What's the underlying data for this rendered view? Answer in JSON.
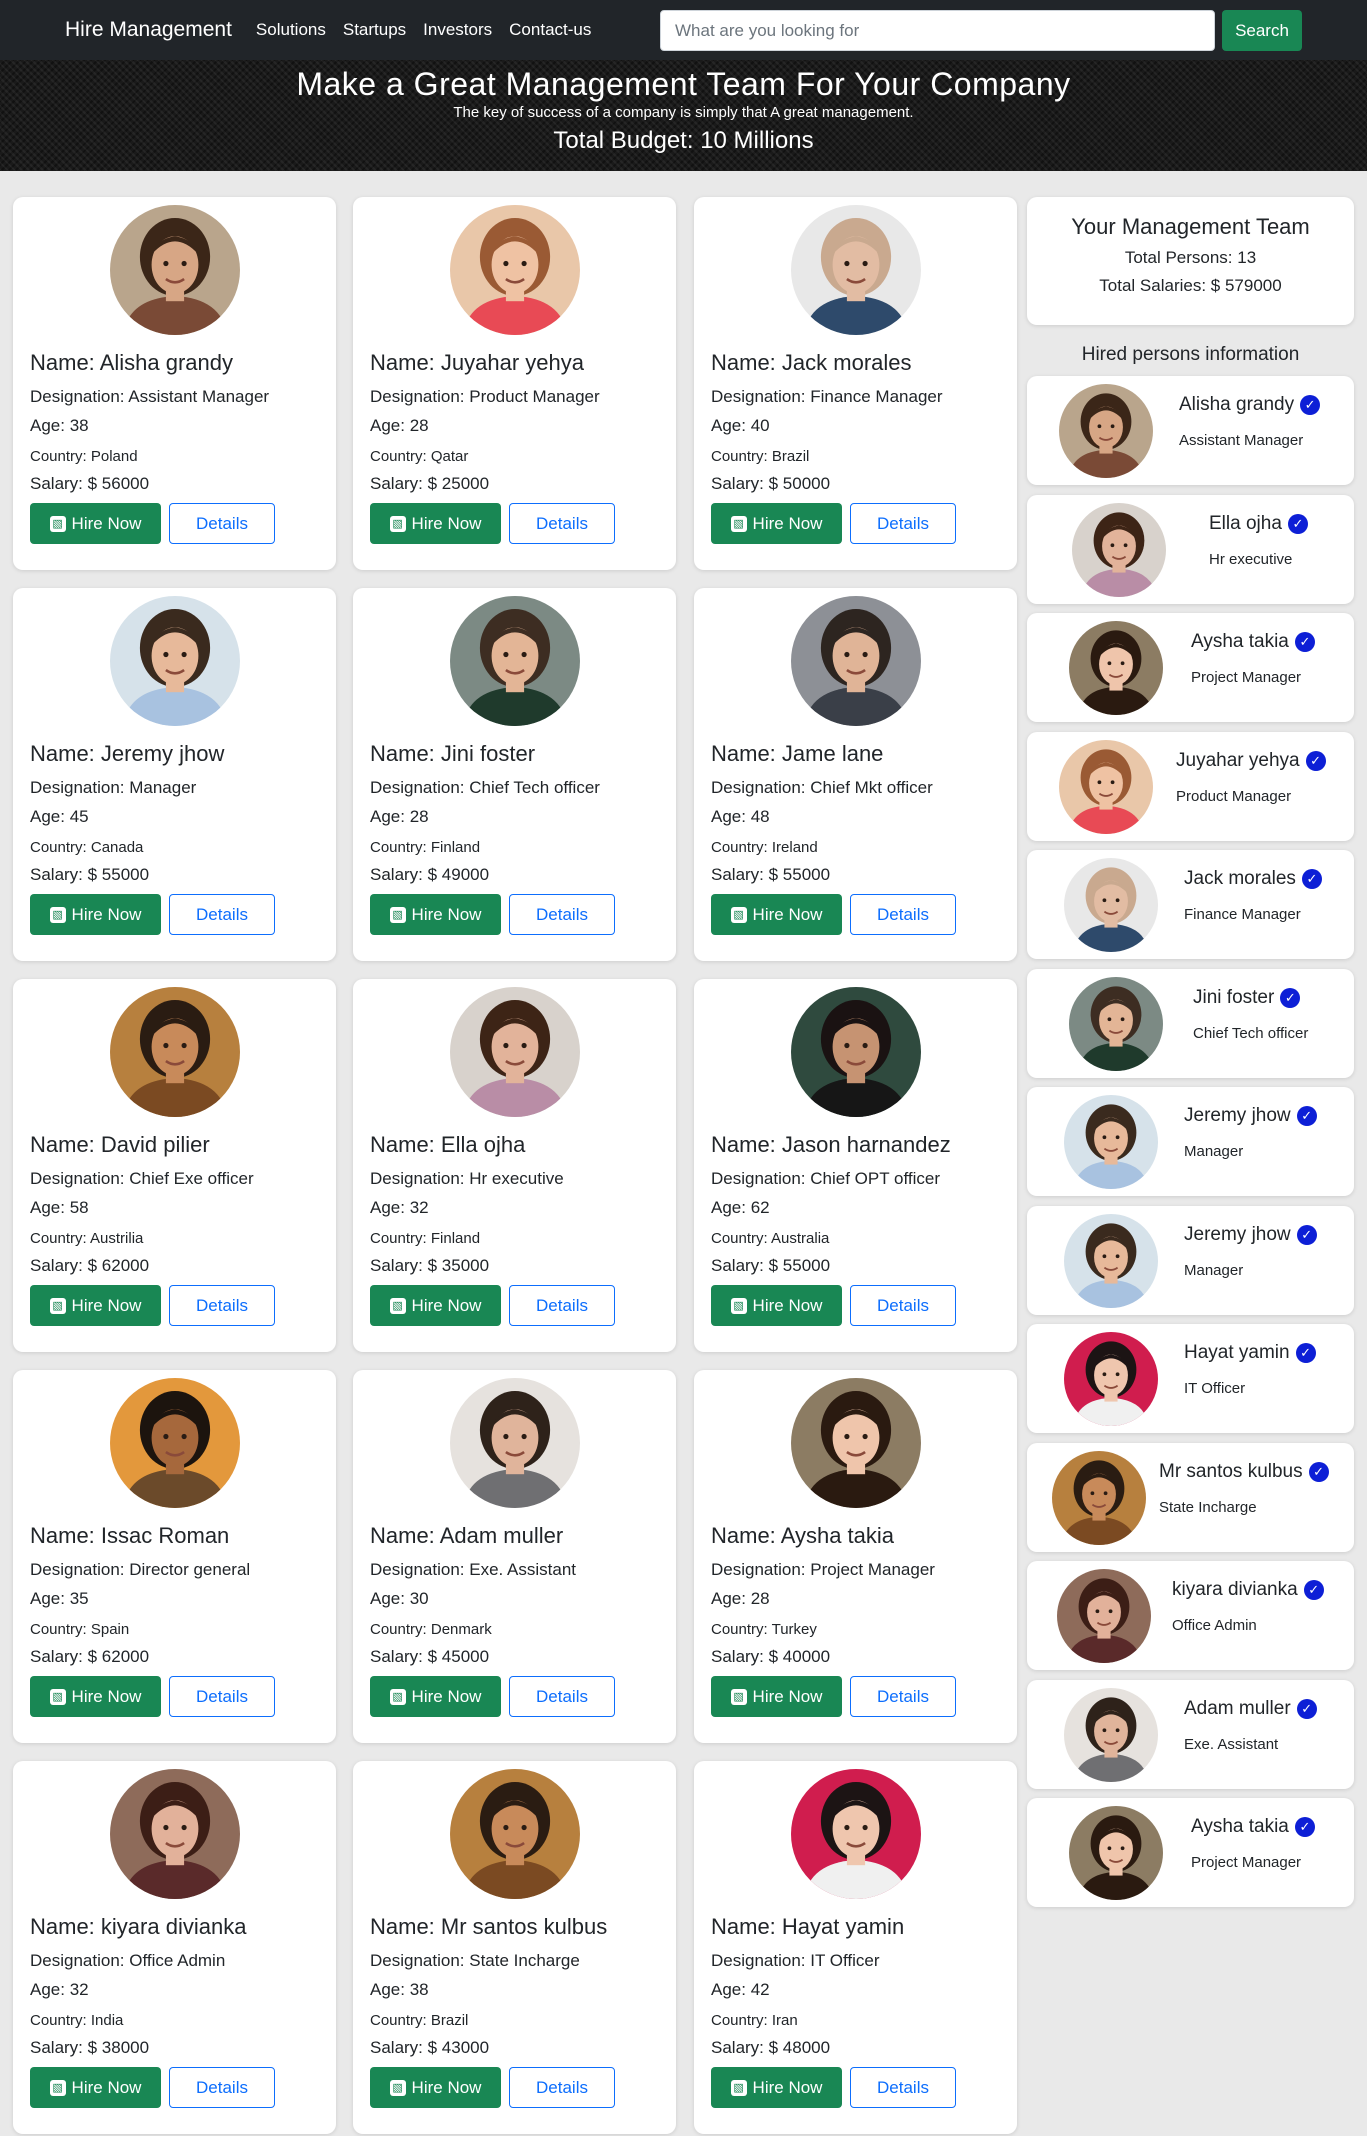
{
  "nav": {
    "brand": "Hire Management",
    "links": [
      "Solutions",
      "Startups",
      "Investors",
      "Contact-us"
    ],
    "search_placeholder": "What are you looking for",
    "search_button": "Search"
  },
  "hero": {
    "title": "Make a Great Management Team For Your Company",
    "subtitle": "The key of success of a company is simply that A great management.",
    "budget": "Total Budget: 10 Millions"
  },
  "buttons": {
    "hire": "Hire Now",
    "details": "Details"
  },
  "cards": [
    {
      "name": "Name: Alisha grandy",
      "designation": "Designation: Assistant Manager",
      "age": "Age: 38",
      "country": "Country: Poland",
      "salary": "Salary: $ 56000",
      "bg": "#b9a58c",
      "hair": "#3b2618",
      "skin": "#d7a685",
      "shirt": "#7a4a36"
    },
    {
      "name": "Name: Juyahar yehya",
      "designation": "Designation: Product Manager",
      "age": "Age: 28",
      "country": "Country: Qatar",
      "salary": "Salary: $ 25000",
      "bg": "#e9c7a9",
      "hair": "#9a5a34",
      "skin": "#efc2a3",
      "shirt": "#e84a55"
    },
    {
      "name": "Name: Jack morales",
      "designation": "Designation: Finance Manager",
      "age": "Age: 40",
      "country": "Country: Brazil",
      "salary": "Salary: $ 50000",
      "bg": "#e8e8e8",
      "hair": "#c9a98f",
      "skin": "#e2bca3",
      "shirt": "#2e4a6b"
    },
    {
      "name": "Name: Jeremy jhow",
      "designation": "Designation: Manager",
      "age": "Age: 45",
      "country": "Country: Canada",
      "salary": "Salary: $ 55000",
      "bg": "#d6e2ea",
      "hair": "#3a2a1e",
      "skin": "#e7b99a",
      "shirt": "#a8c2e0"
    },
    {
      "name": "Name: Jini foster",
      "designation": "Designation: Chief Tech officer",
      "age": "Age: 28",
      "country": "Country: Finland",
      "salary": "Salary: $ 49000",
      "bg": "#7c8a84",
      "hair": "#3d2d22",
      "skin": "#e3b596",
      "shirt": "#1f3a2c"
    },
    {
      "name": "Name: Jame lane",
      "designation": "Designation: Chief Mkt officer",
      "age": "Age: 48",
      "country": "Country: Ireland",
      "salary": "Salary: $ 55000",
      "bg": "#8d9096",
      "hair": "#2d2520",
      "skin": "#e0b497",
      "shirt": "#3a3f48"
    },
    {
      "name": "Name: David pilier",
      "designation": "Designation: Chief Exe officer",
      "age": "Age: 58",
      "country": "Country: Austrilia",
      "salary": "Salary: $ 62000",
      "bg": "#b7803e",
      "hair": "#2a1c12",
      "skin": "#c88a5a",
      "shirt": "#7b4a22"
    },
    {
      "name": "Name: Ella ojha",
      "designation": "Designation: Hr executive",
      "age": "Age: 32",
      "country": "Country: Finland",
      "salary": "Salary: $ 35000",
      "bg": "#d8d2cc",
      "hair": "#3d2416",
      "skin": "#e2b39a",
      "shirt": "#b98da6"
    },
    {
      "name": "Name: Jason harnandez",
      "designation": "Designation: Chief OPT officer",
      "age": "Age: 62",
      "country": "Country: Australia",
      "salary": "Salary: $ 55000",
      "bg": "#2f4a3e",
      "hair": "#1a1212",
      "skin": "#c69372",
      "shirt": "#161616"
    },
    {
      "name": "Name: Issac Roman",
      "designation": "Designation: Director general",
      "age": "Age: 35",
      "country": "Country: Spain",
      "salary": "Salary: $ 62000",
      "bg": "#e3983c",
      "hair": "#1c140e",
      "skin": "#a6683c",
      "shirt": "#6b4a2a"
    },
    {
      "name": "Name: Adam muller",
      "designation": "Designation: Exe. Assistant",
      "age": "Age: 30",
      "country": "Country: Denmark",
      "salary": "Salary: $ 45000",
      "bg": "#e6e2de",
      "hair": "#2e221a",
      "skin": "#e0b49b",
      "shirt": "#6f6f72"
    },
    {
      "name": "Name: Aysha takia",
      "designation": "Designation: Project Manager",
      "age": "Age: 28",
      "country": "Country: Turkey",
      "salary": "Salary: $ 40000",
      "bg": "#8c7c63",
      "hair": "#2a1a10",
      "skin": "#efc5ab",
      "shirt": "#2a1a10"
    },
    {
      "name": "Name: kiyara divianka",
      "designation": "Designation: Office Admin",
      "age": "Age: 32",
      "country": "Country: India",
      "salary": "Salary: $ 38000",
      "bg": "#8e6b5a",
      "hair": "#3c1e16",
      "skin": "#e2b19a",
      "shirt": "#5a2a2a"
    },
    {
      "name": "Name: Mr santos kulbus",
      "designation": "Designation: State Incharge",
      "age": "Age: 38",
      "country": "Country: Brazil",
      "salary": "Salary: $ 43000",
      "bg": "#b7803e",
      "hair": "#2a1c12",
      "skin": "#c88a5a",
      "shirt": "#7b4a22"
    },
    {
      "name": "Name: Hayat yamin",
      "designation": "Designation: IT Officer",
      "age": "Age: 42",
      "country": "Country: Iran",
      "salary": "Salary: $ 48000",
      "bg": "#d01d4e",
      "hair": "#1c1414",
      "skin": "#efc6ae",
      "shirt": "#f0f0f0"
    }
  ],
  "team": {
    "title": "Your Management Team",
    "total_persons": "Total Persons: 13",
    "total_salaries": "Total Salaries: $ 579000"
  },
  "hired_title": "Hired persons information",
  "hired": [
    {
      "name": "Alisha grandy",
      "designation": "Assistant Manager",
      "bg": "#b9a58c",
      "hair": "#3b2618",
      "skin": "#d7a685",
      "shirt": "#7a4a36"
    },
    {
      "name": "Ella ojha",
      "designation": "Hr executive",
      "bg": "#d8d2cc",
      "hair": "#3d2416",
      "skin": "#e2b39a",
      "shirt": "#b98da6"
    },
    {
      "name": "Aysha takia",
      "designation": "Project Manager",
      "bg": "#8c7c63",
      "hair": "#2a1a10",
      "skin": "#efc5ab",
      "shirt": "#2a1a10"
    },
    {
      "name": "Juyahar yehya",
      "designation": "Product Manager",
      "bg": "#e9c7a9",
      "hair": "#9a5a34",
      "skin": "#efc2a3",
      "shirt": "#e84a55"
    },
    {
      "name": "Jack morales",
      "designation": "Finance Manager",
      "bg": "#e8e8e8",
      "hair": "#c9a98f",
      "skin": "#e2bca3",
      "shirt": "#2e4a6b"
    },
    {
      "name": "Jini foster",
      "designation": "Chief Tech officer",
      "bg": "#7c8a84",
      "hair": "#3d2d22",
      "skin": "#e3b596",
      "shirt": "#1f3a2c"
    },
    {
      "name": "Jeremy jhow",
      "designation": "Manager",
      "bg": "#d6e2ea",
      "hair": "#3a2a1e",
      "skin": "#e7b99a",
      "shirt": "#a8c2e0"
    },
    {
      "name": "Jeremy jhow",
      "designation": "Manager",
      "bg": "#d6e2ea",
      "hair": "#3a2a1e",
      "skin": "#e7b99a",
      "shirt": "#a8c2e0"
    },
    {
      "name": "Hayat yamin",
      "designation": "IT Officer",
      "bg": "#d01d4e",
      "hair": "#1c1414",
      "skin": "#efc6ae",
      "shirt": "#f0f0f0"
    },
    {
      "name": "Mr santos kulbus",
      "designation": "State Incharge",
      "bg": "#b7803e",
      "hair": "#2a1c12",
      "skin": "#c88a5a",
      "shirt": "#7b4a22"
    },
    {
      "name": "kiyara divianka",
      "designation": "Office Admin",
      "bg": "#8e6b5a",
      "hair": "#3c1e16",
      "skin": "#e2b19a",
      "shirt": "#5a2a2a"
    },
    {
      "name": "Adam muller",
      "designation": "Exe. Assistant",
      "bg": "#e6e2de",
      "hair": "#2e221a",
      "skin": "#e0b49b",
      "shirt": "#6f6f72"
    },
    {
      "name": "Aysha takia",
      "designation": "Project Manager",
      "bg": "#8c7c63",
      "hair": "#2a1a10",
      "skin": "#efc5ab",
      "shirt": "#2a1a10"
    }
  ]
}
